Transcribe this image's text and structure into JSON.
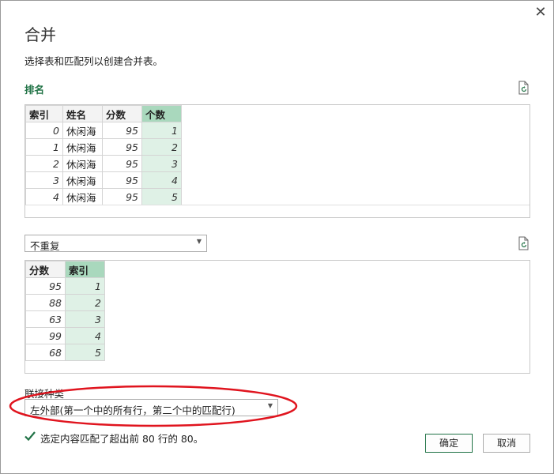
{
  "dialog": {
    "title": "合并",
    "close_symbol": "✕",
    "subtitle": "选择表和匹配列以创建合并表。"
  },
  "table1": {
    "name": "排名",
    "columns": [
      "索引",
      "姓名",
      "分数",
      "个数"
    ],
    "selected_column": "个数",
    "rows": [
      [
        "0",
        "休闲海",
        "95",
        "1"
      ],
      [
        "1",
        "休闲海",
        "95",
        "2"
      ],
      [
        "2",
        "休闲海",
        "95",
        "3"
      ],
      [
        "3",
        "休闲海",
        "95",
        "4"
      ],
      [
        "4",
        "休闲海",
        "95",
        "5"
      ]
    ]
  },
  "table2": {
    "selected_table": "不重复",
    "columns": [
      "分数",
      "索引"
    ],
    "selected_column": "索引",
    "rows": [
      [
        "95",
        "1"
      ],
      [
        "88",
        "2"
      ],
      [
        "63",
        "3"
      ],
      [
        "99",
        "4"
      ],
      [
        "68",
        "5"
      ]
    ]
  },
  "join": {
    "label": "联接种类",
    "value": "左外部(第一个中的所有行，第二个中的匹配行)"
  },
  "status": {
    "text": "选定内容匹配了超出前 80 行的 80。"
  },
  "buttons": {
    "ok": "确定",
    "cancel": "取消"
  },
  "colors": {
    "accent_green": "#217346",
    "selected_header": "#a9d8bd",
    "selected_cell": "#dff1e6",
    "highlight_ellipse": "#e0141e"
  },
  "icons": {
    "refresh": "refresh-icon",
    "check": "check-icon",
    "dropdown": "chevron-down-icon"
  }
}
